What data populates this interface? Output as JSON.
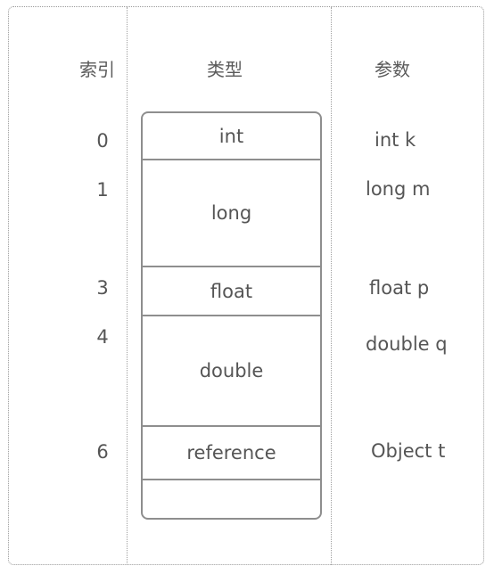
{
  "headers": {
    "index": "索引",
    "type": "类型",
    "param": "参数"
  },
  "slots": [
    {
      "index": "0",
      "type": "int",
      "param": "int k",
      "span": 1
    },
    {
      "index": "1",
      "type": "long",
      "param": "long m",
      "span": 2
    },
    {
      "index": "3",
      "type": "float",
      "param": "float p",
      "span": 1
    },
    {
      "index": "4",
      "type": "double",
      "param": "double q",
      "span": 2
    },
    {
      "index": "6",
      "type": "reference",
      "param": "Object t",
      "span": 1
    },
    {
      "index": "",
      "type": "",
      "param": "",
      "span": 1
    }
  ]
}
